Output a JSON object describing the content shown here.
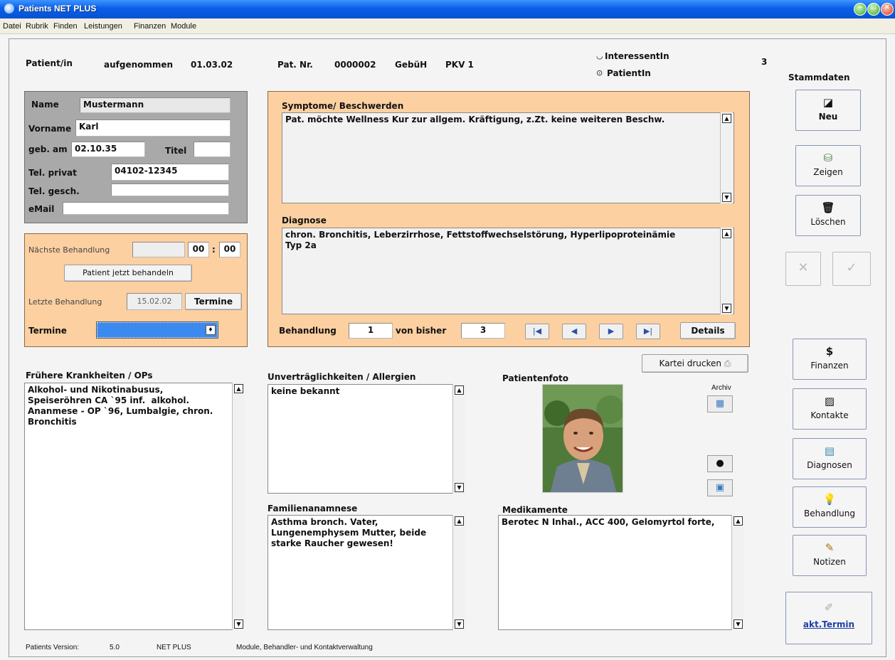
{
  "window": {
    "title": "Patients NET PLUS"
  },
  "menu": [
    "Datei",
    "Rubrik",
    "Finden",
    "Leistungen",
    "Finanzen",
    "Module"
  ],
  "header": {
    "patient_label": "Patient/in",
    "admitted_label": "aufgenommen",
    "admitted_date": "01.03.02",
    "patnr_label": "Pat. Nr.",
    "patnr_value": "0000002",
    "gebuh_label": "GebüH",
    "gebuh_value": "PKV 1",
    "radio_interessent": "InteressentIn",
    "radio_patient": "PatientIn",
    "count": "3",
    "stammdaten": "Stammdaten"
  },
  "person": {
    "name_label": "Name",
    "name_value": "Mustermann",
    "vorname_label": "Vorname",
    "vorname_value": "Karl",
    "geb_label": "geb. am",
    "geb_value": "02.10.35",
    "titel_label": "Titel",
    "titel_value": "",
    "telprivat_label": "Tel. privat",
    "telprivat_value": "04102-12345",
    "telgesch_label": "Tel. gesch.",
    "telgesch_value": "",
    "email_label": "eMail",
    "email_value": ""
  },
  "treatment": {
    "next_label": "Nächste Behandlung",
    "next_date": "",
    "next_hour": "00",
    "colon": ":",
    "next_min": "00",
    "treat_now_button": "Patient jetzt behandeln",
    "last_label": "Letzte Behandlung",
    "last_date": "15.02.02",
    "termine_button": "Termine",
    "termine_label": "Termine"
  },
  "symptoms": {
    "label": "Symptome/ Beschwerden",
    "text": "Pat. möchte Wellness Kur zur allgem. Kräftigung, z.Zt. keine weiteren Beschw."
  },
  "diagnose": {
    "label": "Diagnose",
    "text": "chron. Bronchitis, Leberzirrhose, Fettstoffwechselstörung, Hyperlipoproteinämie\nTyp 2a"
  },
  "behandlung": {
    "label": "Behandlung",
    "current": "1",
    "of_label": "von bisher",
    "total": "3",
    "details_button": "Details"
  },
  "print_button": "Kartei drucken",
  "sections": {
    "fruehere_label": "Frühere Krankheiten / OPs",
    "fruehere_text": "Alkohol- und Nikotinabusus,\nSpeiseröhren CA `95 inf.  alkohol.\nAnanmese - OP `96, Lumbalgie, chron.\nBronchitis",
    "allergien_label": "Unverträglichkeiten / Allergien",
    "allergien_text": "keine bekannt",
    "familie_label": "Familienanamnese",
    "familie_text": "Asthma bronch. Vater,\nLungenemphysem Mutter, beide\nstarke Raucher gewesen!",
    "foto_label": "Patientenfoto",
    "archiv_label": "Archiv",
    "medikamente_label": "Medikamente",
    "medikamente_text": "Berotec N Inhal., ACC 400, Gelomyrtol forte,"
  },
  "side_buttons": {
    "neu": "Neu",
    "zeigen": "Zeigen",
    "loeschen": "Löschen",
    "cancel": "✕",
    "confirm": "✓",
    "finanzen": "Finanzen",
    "kontakte": "Kontakte",
    "diagnosen": "Diagnosen",
    "behandlung": "Behandlung",
    "notizen": "Notizen",
    "akt_termin": "akt.Termin"
  },
  "status": {
    "version_label": "Patients Version:",
    "version": "5.0",
    "edition": "NET PLUS",
    "modules": "Module, Behandler- und Kontaktverwaltung"
  }
}
